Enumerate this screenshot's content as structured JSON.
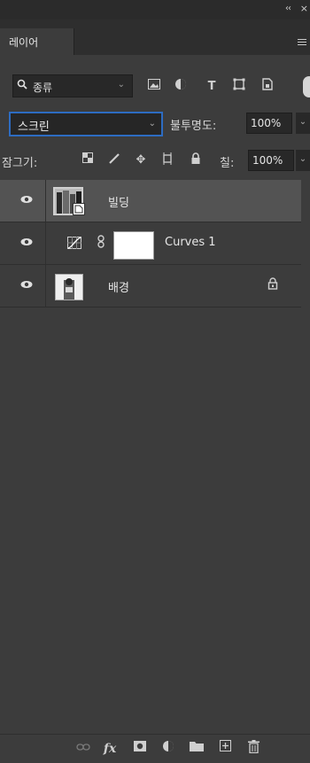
{
  "window": {
    "collapse_glyph": "‹‹",
    "close_glyph": "×"
  },
  "tabs": [
    {
      "label": "레이어"
    }
  ],
  "filter": {
    "kind_label": "종류",
    "kind_icon": "search-icon",
    "icons": [
      "image-icon",
      "adjustment-circle-icon",
      "type-icon",
      "shape-icon",
      "smart-object-icon"
    ]
  },
  "blend": {
    "mode": "스크린",
    "opacity_label": "불투명도:",
    "opacity_value": "100%"
  },
  "lock": {
    "label": "잠그기:",
    "icons": [
      "lock-transparent-icon",
      "lock-paint-icon",
      "lock-move-icon",
      "lock-artboard-icon",
      "lock-all-icon"
    ],
    "fill_label": "칠:",
    "fill_value": "100%"
  },
  "layers": [
    {
      "name": "빌딩",
      "type": "smart-object",
      "visible": true,
      "selected": true
    },
    {
      "name": "Curves 1",
      "type": "adjustment-curves",
      "visible": true,
      "selected": false,
      "has_mask": true
    },
    {
      "name": "배경",
      "type": "background",
      "visible": true,
      "selected": false,
      "locked": true
    }
  ],
  "bottom_icons": [
    "link-icon",
    "fx-icon",
    "add-mask-icon",
    "new-adjustment-icon",
    "new-group-icon",
    "new-layer-icon",
    "trash-icon"
  ],
  "bottom_labels": {
    "fx": "fx"
  },
  "colors": {
    "panel": "#3c3c3c",
    "selected_row": "#535353",
    "focus_border": "#2d6cc2"
  }
}
